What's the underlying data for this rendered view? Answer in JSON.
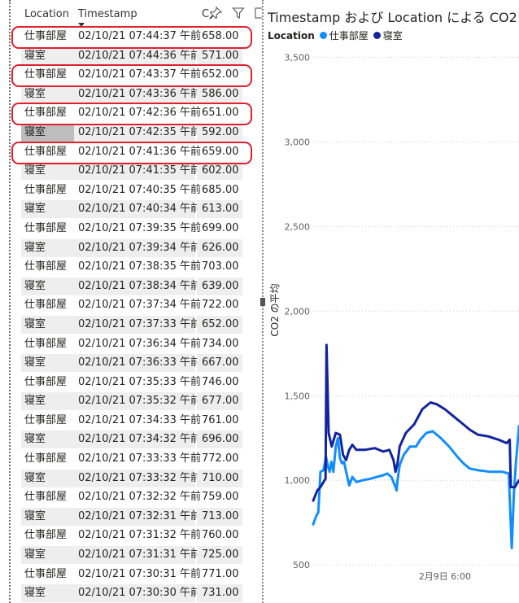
{
  "table": {
    "headers": {
      "location": "Location",
      "timestamp": "Timestamp",
      "value_truncated": "C"
    },
    "rows": [
      {
        "location": "仕事部屋",
        "timestamp": "02/10/21 07:44:37 午前",
        "value": "658.00"
      },
      {
        "location": "寝室",
        "timestamp": "02/10/21 07:44:36 午前",
        "value": "571.00"
      },
      {
        "location": "仕事部屋",
        "timestamp": "02/10/21 07:43:37 午前",
        "value": "652.00"
      },
      {
        "location": "寝室",
        "timestamp": "02/10/21 07:43:36 午前",
        "value": "586.00"
      },
      {
        "location": "仕事部屋",
        "timestamp": "02/10/21 07:42:36 午前",
        "value": "651.00"
      },
      {
        "location": "寝室",
        "timestamp": "02/10/21 07:42:35 午前",
        "value": "592.00"
      },
      {
        "location": "仕事部屋",
        "timestamp": "02/10/21 07:41:36 午前",
        "value": "659.00"
      },
      {
        "location": "寝室",
        "timestamp": "02/10/21 07:41:35 午前",
        "value": "602.00"
      },
      {
        "location": "仕事部屋",
        "timestamp": "02/10/21 07:40:35 午前",
        "value": "685.00"
      },
      {
        "location": "寝室",
        "timestamp": "02/10/21 07:40:34 午前",
        "value": "613.00"
      },
      {
        "location": "仕事部屋",
        "timestamp": "02/10/21 07:39:35 午前",
        "value": "699.00"
      },
      {
        "location": "寝室",
        "timestamp": "02/10/21 07:39:34 午前",
        "value": "626.00"
      },
      {
        "location": "仕事部屋",
        "timestamp": "02/10/21 07:38:35 午前",
        "value": "703.00"
      },
      {
        "location": "寝室",
        "timestamp": "02/10/21 07:38:34 午前",
        "value": "639.00"
      },
      {
        "location": "仕事部屋",
        "timestamp": "02/10/21 07:37:34 午前",
        "value": "722.00"
      },
      {
        "location": "寝室",
        "timestamp": "02/10/21 07:37:33 午前",
        "value": "652.00"
      },
      {
        "location": "仕事部屋",
        "timestamp": "02/10/21 07:36:34 午前",
        "value": "734.00"
      },
      {
        "location": "寝室",
        "timestamp": "02/10/21 07:36:33 午前",
        "value": "667.00"
      },
      {
        "location": "仕事部屋",
        "timestamp": "02/10/21 07:35:33 午前",
        "value": "746.00"
      },
      {
        "location": "寝室",
        "timestamp": "02/10/21 07:35:32 午前",
        "value": "677.00"
      },
      {
        "location": "仕事部屋",
        "timestamp": "02/10/21 07:34:33 午前",
        "value": "761.00"
      },
      {
        "location": "寝室",
        "timestamp": "02/10/21 07:34:32 午前",
        "value": "696.00"
      },
      {
        "location": "仕事部屋",
        "timestamp": "02/10/21 07:33:33 午前",
        "value": "772.00"
      },
      {
        "location": "寝室",
        "timestamp": "02/10/21 07:33:32 午前",
        "value": "710.00"
      },
      {
        "location": "仕事部屋",
        "timestamp": "02/10/21 07:32:32 午前",
        "value": "759.00"
      },
      {
        "location": "寝室",
        "timestamp": "02/10/21 07:32:31 午前",
        "value": "713.00"
      },
      {
        "location": "仕事部屋",
        "timestamp": "02/10/21 07:31:32 午前",
        "value": "760.00"
      },
      {
        "location": "寝室",
        "timestamp": "02/10/21 07:31:31 午前",
        "value": "725.00"
      },
      {
        "location": "仕事部屋",
        "timestamp": "02/10/21 07:30:31 午前",
        "value": "771.00"
      },
      {
        "location": "寝室",
        "timestamp": "02/10/21 07:30:30 午前",
        "value": "731.00"
      }
    ],
    "selected_row_index": 5,
    "highlighted_row_indices": [
      0,
      2,
      4,
      6
    ],
    "icons": [
      "pin-icon",
      "filter-icon",
      "focus-mode-icon"
    ]
  },
  "chart": {
    "title": "Timestamp および Location による CO2",
    "legend_title": "Location"
  },
  "chart_data": {
    "type": "line",
    "ylabel": "CO2 の平均",
    "ylim": [
      400,
      3550
    ],
    "yticks": [
      "3,500",
      "3,000",
      "2,500",
      "2,000",
      "1,500",
      "1,000",
      "500"
    ],
    "ytick_values": [
      3500,
      3000,
      2500,
      2000,
      1500,
      1000,
      500
    ],
    "x_tick_labels": [
      "2月9日 6:00"
    ],
    "x_tick_fracs": [
      0.64
    ],
    "grid": true,
    "legend": "top-left",
    "series": [
      {
        "name": "仕事部屋",
        "color": "#118dff",
        "points": [
          [
            0.0,
            740
          ],
          [
            0.015,
            790
          ],
          [
            0.025,
            810
          ],
          [
            0.035,
            1050
          ],
          [
            0.05,
            1060
          ],
          [
            0.062,
            1140
          ],
          [
            0.072,
            1080
          ],
          [
            0.08,
            1050
          ],
          [
            0.088,
            1110
          ],
          [
            0.098,
            1050
          ],
          [
            0.11,
            1200
          ],
          [
            0.12,
            1250
          ],
          [
            0.13,
            1130
          ],
          [
            0.14,
            1100
          ],
          [
            0.15,
            1110
          ],
          [
            0.16,
            1050
          ],
          [
            0.175,
            970
          ],
          [
            0.19,
            1020
          ],
          [
            0.21,
            990
          ],
          [
            0.24,
            1000
          ],
          [
            0.28,
            1010
          ],
          [
            0.31,
            1020
          ],
          [
            0.34,
            1030
          ],
          [
            0.36,
            1040
          ],
          [
            0.38,
            1020
          ],
          [
            0.4,
            960
          ],
          [
            0.405,
            940
          ],
          [
            0.41,
            1000
          ],
          [
            0.42,
            1090
          ],
          [
            0.44,
            1150
          ],
          [
            0.47,
            1200
          ],
          [
            0.5,
            1200
          ],
          [
            0.52,
            1240
          ],
          [
            0.55,
            1280
          ],
          [
            0.58,
            1290
          ],
          [
            0.62,
            1250
          ],
          [
            0.66,
            1200
          ],
          [
            0.7,
            1140
          ],
          [
            0.73,
            1100
          ],
          [
            0.76,
            1070
          ],
          [
            0.8,
            1060
          ],
          [
            0.86,
            1050
          ],
          [
            0.92,
            1050
          ],
          [
            0.95,
            1040
          ],
          [
            0.958,
            800
          ],
          [
            0.965,
            600
          ],
          [
            0.975,
            920
          ],
          [
            0.985,
            1100
          ],
          [
            1.0,
            1320
          ]
        ]
      },
      {
        "name": "寝室",
        "color": "#12239e",
        "points": [
          [
            0.0,
            880
          ],
          [
            0.02,
            940
          ],
          [
            0.035,
            960
          ],
          [
            0.05,
            990
          ],
          [
            0.06,
            1010
          ],
          [
            0.065,
            1800
          ],
          [
            0.075,
            1280
          ],
          [
            0.09,
            1200
          ],
          [
            0.1,
            1240
          ],
          [
            0.11,
            1280
          ],
          [
            0.13,
            1270
          ],
          [
            0.145,
            1150
          ],
          [
            0.16,
            1120
          ],
          [
            0.175,
            1180
          ],
          [
            0.19,
            1210
          ],
          [
            0.21,
            1180
          ],
          [
            0.25,
            1180
          ],
          [
            0.3,
            1190
          ],
          [
            0.34,
            1170
          ],
          [
            0.37,
            1180
          ],
          [
            0.39,
            1120
          ],
          [
            0.4,
            1050
          ],
          [
            0.41,
            1100
          ],
          [
            0.42,
            1200
          ],
          [
            0.45,
            1280
          ],
          [
            0.49,
            1330
          ],
          [
            0.53,
            1420
          ],
          [
            0.57,
            1460
          ],
          [
            0.6,
            1450
          ],
          [
            0.64,
            1420
          ],
          [
            0.68,
            1380
          ],
          [
            0.72,
            1340
          ],
          [
            0.76,
            1300
          ],
          [
            0.8,
            1270
          ],
          [
            0.85,
            1260
          ],
          [
            0.9,
            1240
          ],
          [
            0.94,
            1220
          ],
          [
            0.955,
            1240
          ],
          [
            0.96,
            960
          ],
          [
            0.98,
            960
          ],
          [
            1.0,
            1000
          ]
        ]
      }
    ]
  }
}
